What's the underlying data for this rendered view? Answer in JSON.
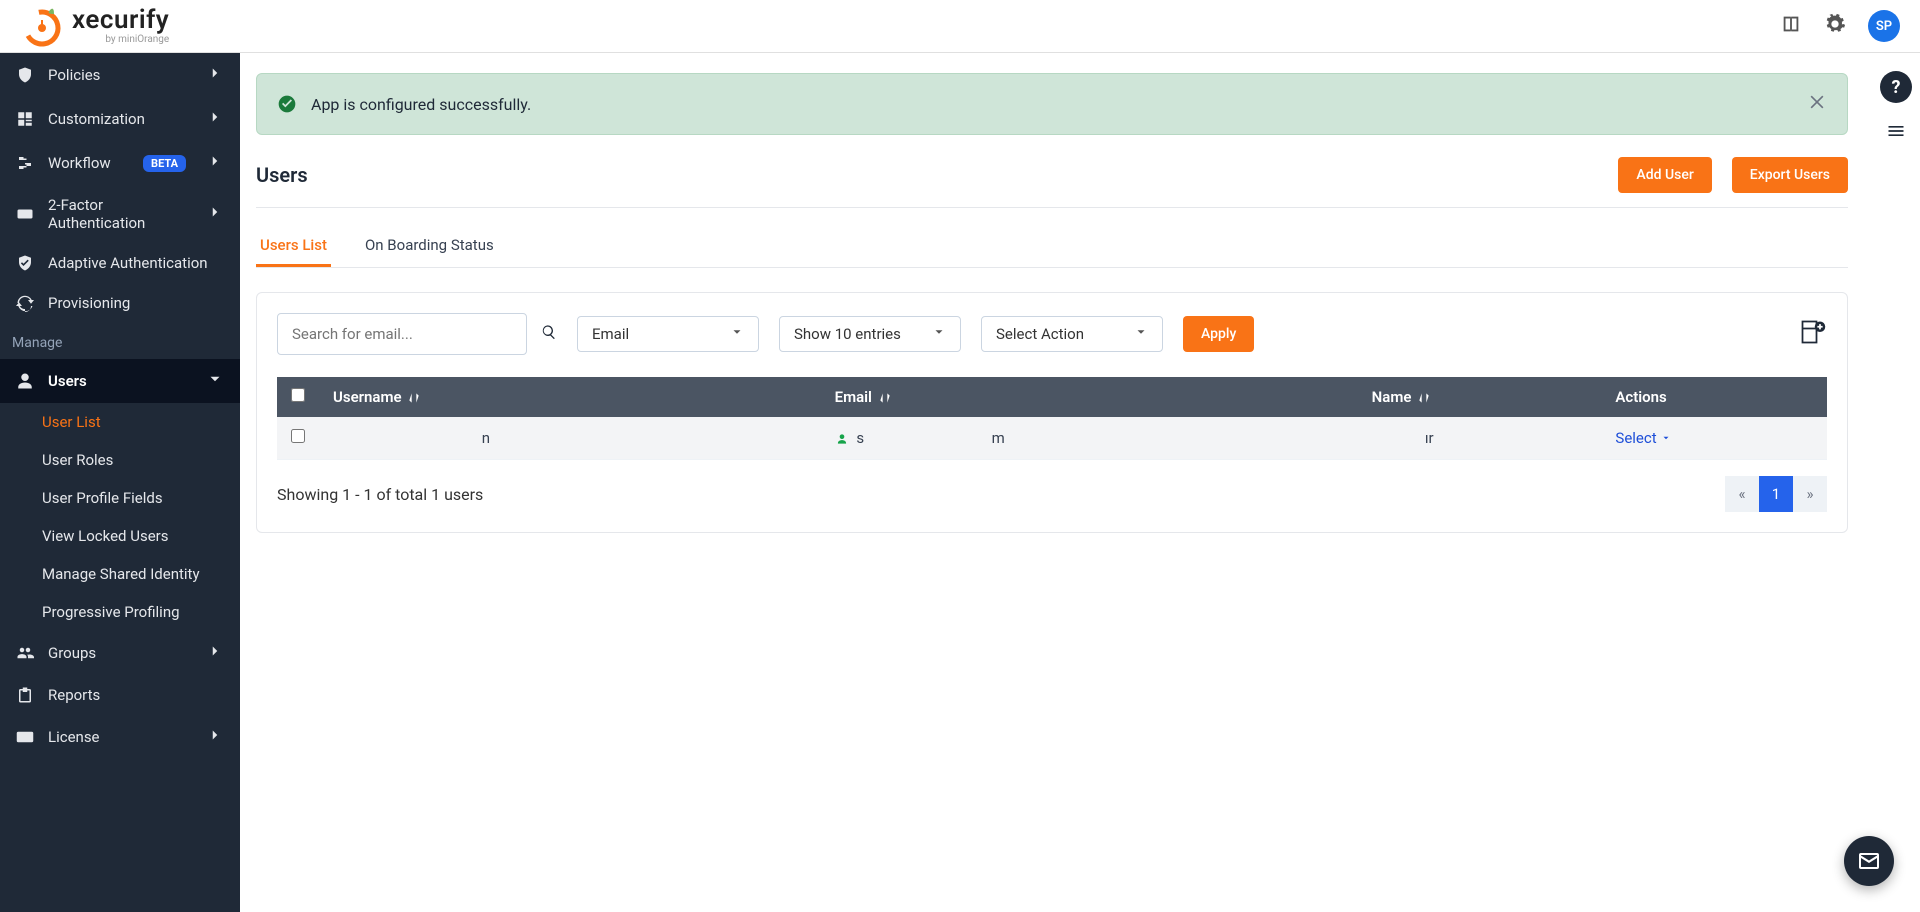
{
  "brand": {
    "name": "xecurify",
    "byline": "by miniOrange"
  },
  "avatar": "SP",
  "alert": {
    "message": "App is configured successfully."
  },
  "sidebar": {
    "items": [
      {
        "label": "Policies",
        "icon": "shield-gear"
      },
      {
        "label": "Customization",
        "icon": "grid"
      },
      {
        "label": "Workflow",
        "icon": "flow",
        "beta": "BETA"
      },
      {
        "label": "2-Factor Authentication",
        "icon": "123"
      },
      {
        "label": "Adaptive Authentication",
        "icon": "shield"
      },
      {
        "label": "Provisioning",
        "icon": "sync"
      }
    ],
    "section_label": "Manage",
    "users_label": "Users",
    "users_sub": [
      {
        "label": "User List",
        "active": true
      },
      {
        "label": "User Roles"
      },
      {
        "label": "User Profile Fields"
      },
      {
        "label": "View Locked Users"
      },
      {
        "label": "Manage Shared Identity"
      },
      {
        "label": "Progressive Profiling"
      }
    ],
    "trailing": [
      {
        "label": "Groups",
        "icon": "groups"
      },
      {
        "label": "Reports",
        "icon": "clipboard"
      },
      {
        "label": "License",
        "icon": "card"
      }
    ]
  },
  "page": {
    "title": "Users",
    "add_btn": "Add User",
    "export_btn": "Export Users"
  },
  "tabs": {
    "list": "Users List",
    "onboard": "On Boarding Status"
  },
  "toolbar": {
    "search_placeholder": "Search for email...",
    "filter": "Email",
    "entries": "Show 10 entries",
    "action": "Select Action",
    "apply": "Apply"
  },
  "table": {
    "cols": {
      "username": "Username",
      "email": "Email",
      "name": "Name",
      "actions": "Actions"
    },
    "rows": [
      {
        "username_prefix": "",
        "username_hidden": "██████████████",
        "username_suffix": "n",
        "email_prefix": "s",
        "email_hidden": "████████████",
        "email_suffix": "m",
        "name_prefix": "",
        "name_hidden": "█████",
        "name_suffix": "ır",
        "action": "Select"
      }
    ],
    "summary": "Showing 1 - 1 of total 1 users",
    "page": "1"
  }
}
